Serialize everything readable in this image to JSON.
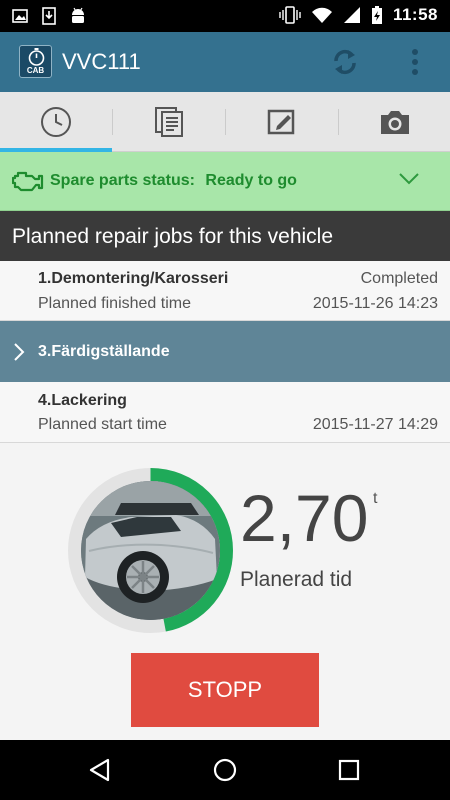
{
  "status_bar": {
    "time": "11:58",
    "left_icons": [
      "image-icon",
      "download-icon",
      "android-icon"
    ],
    "right_icons": [
      "vibrate-icon",
      "wifi-icon",
      "signal-icon",
      "battery-charging-icon"
    ]
  },
  "app_bar": {
    "logo_text": "CAB",
    "title": "VVC111",
    "actions": [
      "refresh-icon",
      "overflow-menu-icon"
    ],
    "color": "#34718f"
  },
  "tabs": [
    {
      "icon": "clock-icon",
      "active": true
    },
    {
      "icon": "documents-icon",
      "active": false
    },
    {
      "icon": "edit-icon",
      "active": false
    },
    {
      "icon": "camera-icon",
      "active": false
    }
  ],
  "spare_parts": {
    "label": "Spare parts status:",
    "value": "Ready to go",
    "icon": "engine-icon",
    "color": "#1e8c2e"
  },
  "section_header": "Planned repair jobs for this vehicle",
  "jobs": [
    {
      "name": "1.Demontering/Karosseri",
      "status": "Completed",
      "time_label": "Planned finished time",
      "time_value": "2015-11-26 14:23"
    },
    {
      "name": "3.Färdigställande"
    },
    {
      "name": "4.Lackering",
      "time_label": "Planned start time",
      "time_value": "2015-11-27 14:29"
    }
  ],
  "timer": {
    "value": "2,70",
    "unit": "t",
    "label": "Planerad tid",
    "progress_fraction": 0.47,
    "progress_color": "#1faa59"
  },
  "stop_button": {
    "label": "STOPP",
    "color": "#e04b40"
  },
  "nav_bar": [
    "back-icon",
    "home-icon",
    "recents-icon"
  ]
}
